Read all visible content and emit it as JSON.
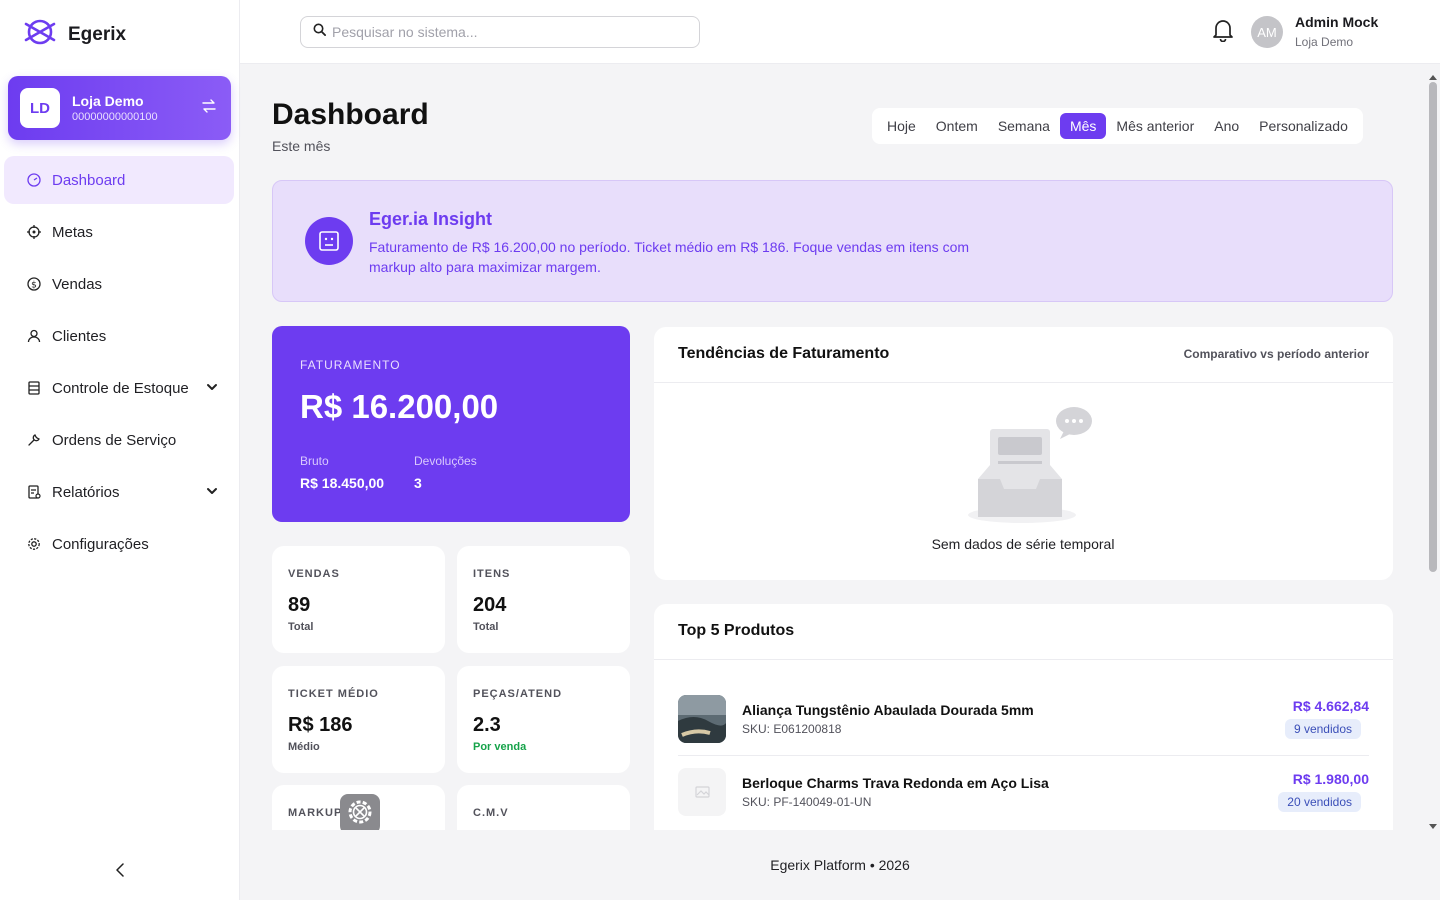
{
  "brand": {
    "name": "Egerix",
    "accent": "#6d3cf0"
  },
  "store": {
    "initials": "LD",
    "name": "Loja Demo",
    "id": "00000000000100"
  },
  "nav": {
    "items": [
      {
        "label": "Dashboard",
        "icon": "dashboard-icon",
        "active": true
      },
      {
        "label": "Metas",
        "icon": "target-icon"
      },
      {
        "label": "Vendas",
        "icon": "dollar-icon"
      },
      {
        "label": "Clientes",
        "icon": "user-icon"
      },
      {
        "label": "Controle de Estoque",
        "icon": "inventory-icon",
        "expandable": true
      },
      {
        "label": "Ordens de Serviço",
        "icon": "wrench-icon"
      },
      {
        "label": "Relatórios",
        "icon": "report-icon",
        "expandable": true
      },
      {
        "label": "Configurações",
        "icon": "gear-icon"
      }
    ]
  },
  "search": {
    "placeholder": "Pesquisar no sistema..."
  },
  "user": {
    "initials": "AM",
    "name": "Admin Mock",
    "store": "Loja Demo"
  },
  "page": {
    "title": "Dashboard",
    "subtitle": "Este mês"
  },
  "periods": {
    "items": [
      "Hoje",
      "Ontem",
      "Semana",
      "Mês",
      "Mês anterior",
      "Ano",
      "Personalizado"
    ],
    "active": "Mês"
  },
  "insight": {
    "title": "Eger.ia Insight",
    "text": "Faturamento de R$ 16.200,00 no período. Ticket médio em R$ 186. Foque vendas em itens com markup alto para maximizar margem."
  },
  "revenue": {
    "label": "FATURAMENTO",
    "value": "R$ 16.200,00",
    "gross_label": "Bruto",
    "gross_value": "R$ 18.450,00",
    "returns_label": "Devoluções",
    "returns_value": "3"
  },
  "kpis": {
    "vendas": {
      "label": "VENDAS",
      "value": "89",
      "sub": "Total"
    },
    "itens": {
      "label": "ITENS",
      "value": "204",
      "sub": "Total"
    },
    "ticket": {
      "label": "TICKET MÉDIO",
      "value": "R$ 186",
      "sub": "Médio"
    },
    "pecas": {
      "label": "PEÇAS/ATEND",
      "value": "2.3",
      "sub": "Por venda"
    },
    "markup": {
      "label": "MARKUP"
    },
    "cmv": {
      "label": "C.M.V"
    }
  },
  "trends": {
    "title": "Tendências de Faturamento",
    "note": "Comparativo vs período anterior",
    "empty": "Sem dados de série temporal"
  },
  "top_products": {
    "title": "Top 5 Produtos",
    "items": [
      {
        "name": "Aliança Tungstênio Abaulada Dourada 5mm",
        "sku": "SKU: E061200818",
        "price": "R$ 4.662,84",
        "sold": "9 vendidos"
      },
      {
        "name": "Berloque Charms Trava Redonda em Aço Lisa",
        "sku": "SKU: PF-140049-01-UN",
        "price": "R$ 1.980,00",
        "sold": "20 vendidos"
      }
    ]
  },
  "footer": {
    "text": "Egerix Platform • 2026"
  }
}
